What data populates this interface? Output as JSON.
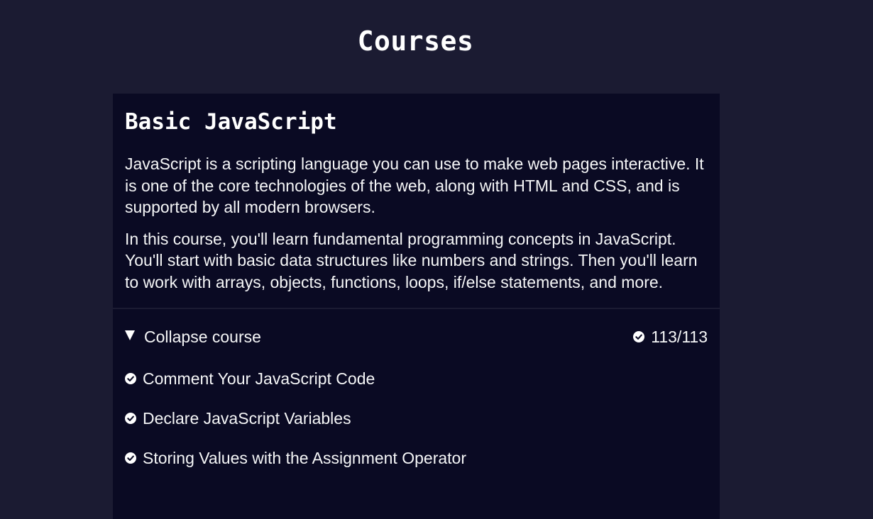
{
  "page": {
    "title": "Courses"
  },
  "course": {
    "heading": "Basic JavaScript",
    "description_1": "JavaScript is a scripting language you can use to make web pages interactive. It is one of the core technologies of the web, along with HTML and CSS, and is supported by all modern browsers.",
    "description_2": "In this course, you'll learn fundamental programming concepts in JavaScript. You'll start with basic data structures like numbers and strings. Then you'll learn to work with arrays, objects, functions, loops, if/else statements, and more.",
    "collapse_label": "Collapse course",
    "collapse_icon": "triangle-down-icon",
    "progress_icon": "check-circle-icon",
    "progress_text": "113/113",
    "lessons": [
      {
        "label": "Comment Your JavaScript Code",
        "icon": "check-circle-icon"
      },
      {
        "label": "Declare JavaScript Variables",
        "icon": "check-circle-icon"
      },
      {
        "label": "Storing Values with the Assignment Operator",
        "icon": "check-circle-icon"
      }
    ]
  },
  "colors": {
    "page_background": "#1b1b32",
    "card_background": "#0a0a23",
    "text": "#f5f6f7"
  }
}
